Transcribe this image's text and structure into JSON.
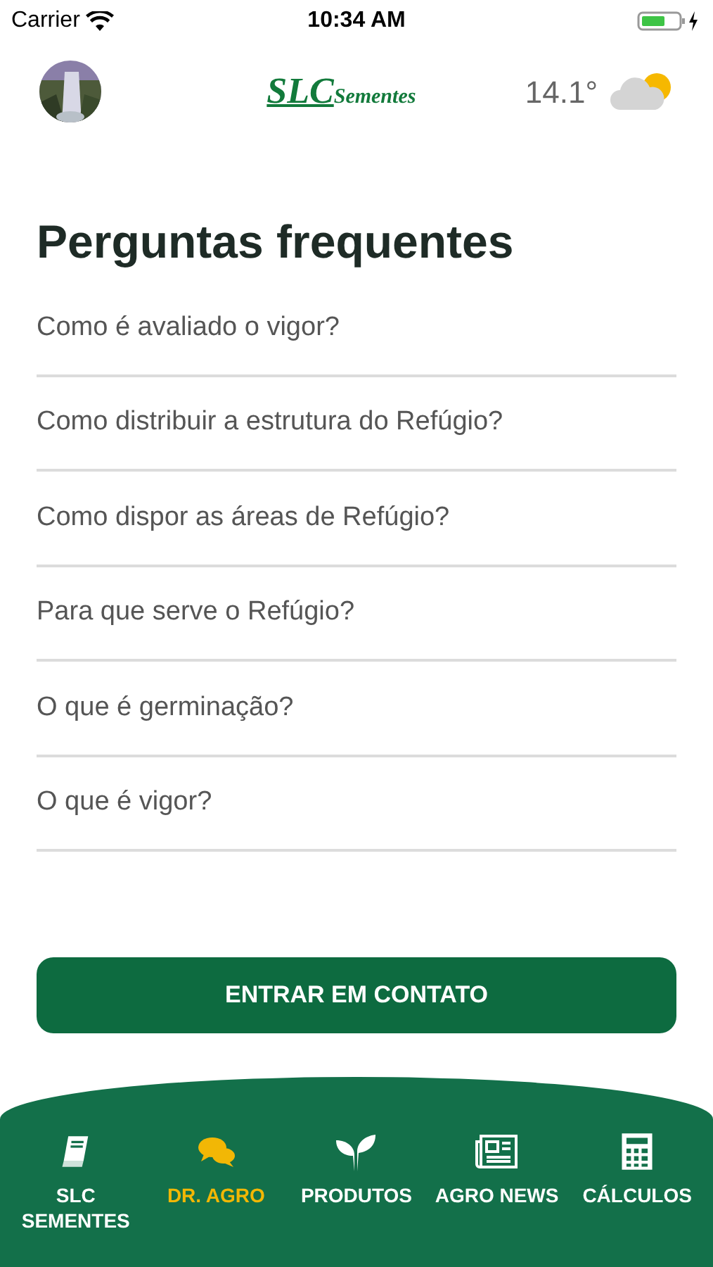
{
  "status_bar": {
    "carrier": "Carrier",
    "time": "10:34 AM"
  },
  "header": {
    "logo_main": "SLC",
    "logo_sub": "Sementes",
    "temperature": "14.1°"
  },
  "title": "Perguntas frequentes",
  "questions": [
    "Como é avaliado o vigor?",
    "Como distribuir a estrutura do Refúgio?",
    "Como dispor as áreas de Refúgio?",
    "Para que serve o Refúgio?",
    "O que é germinação?",
    "O que é vigor?"
  ],
  "contact_button": "ENTRAR EM CONTATO",
  "tab_bar": [
    {
      "label": "SLC SEMENTES",
      "kind": "book",
      "selected": false
    },
    {
      "label": "DR. AGRO",
      "kind": "chat",
      "selected": true
    },
    {
      "label": "PRODUTOS",
      "kind": "sprout",
      "selected": false
    },
    {
      "label": "AGRO NEWS",
      "kind": "news",
      "selected": false
    },
    {
      "label": "CÁLCULOS",
      "kind": "calc",
      "selected": false
    }
  ]
}
